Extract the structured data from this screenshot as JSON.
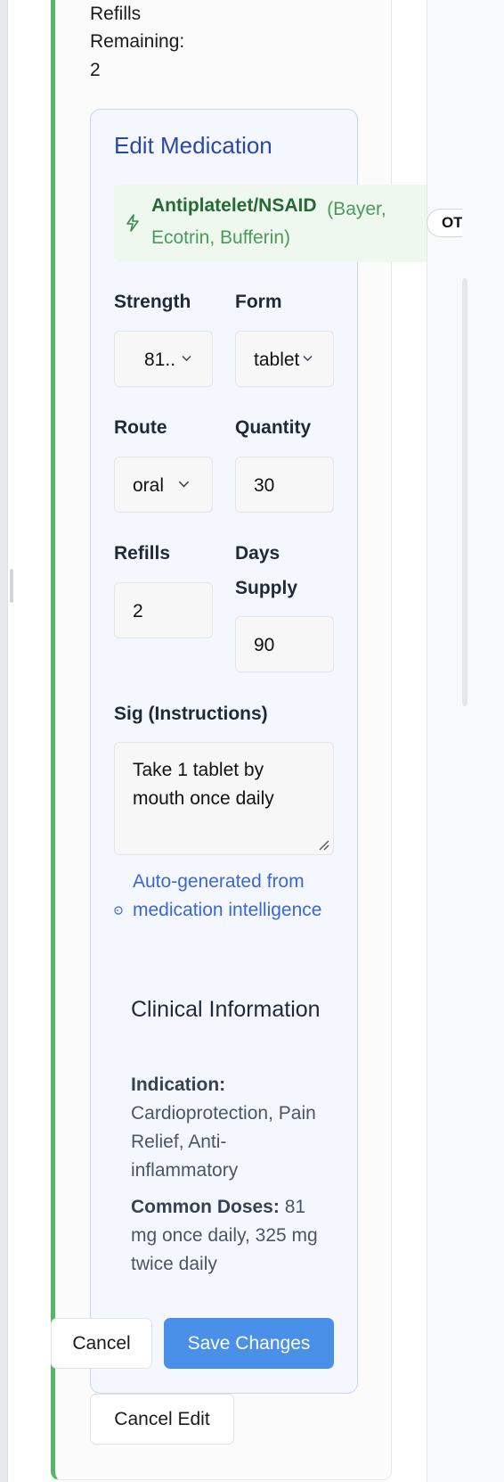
{
  "prescription": {
    "refills_remaining_label_line1": "Refills",
    "refills_remaining_label_line2": "Remaining:",
    "refills_remaining_value": "2"
  },
  "edit": {
    "title": "Edit Medication",
    "alert": {
      "drug_class": "Antiplatelet/NSAID",
      "brands": "(Bayer, Ecotrin, Bufferin)",
      "badge": "OTC",
      "icon": "lightning-icon",
      "color": "#256a35"
    },
    "fields": {
      "strength": {
        "label": "Strength",
        "value": "81..."
      },
      "form": {
        "label": "Form",
        "value": "tablet"
      },
      "route": {
        "label": "Route",
        "value": "oral"
      },
      "quantity": {
        "label": "Quantity",
        "value": "30"
      },
      "refills": {
        "label": "Refills",
        "value": "2"
      },
      "days_supply": {
        "label_line1": "Days",
        "label_line2": "Supply",
        "value": "90"
      }
    },
    "sig": {
      "label": "Sig (Instructions)",
      "value": "Take 1 tablet by mouth once daily"
    },
    "auto_note": "Auto-generated from medication intelligence",
    "clinical": {
      "title": "Clinical Information",
      "indication_label": "Indication:",
      "indication_value": "Cardioprotection, Pain Relief, Anti-inflammatory",
      "doses_label": "Common Doses:",
      "doses_value": "81 mg once daily, 325 mg twice daily"
    },
    "buttons": {
      "cancel": "Cancel",
      "save": "Save Changes",
      "cancel_edit": "Cancel Edit"
    }
  },
  "colors": {
    "accent_green": "#4fba63",
    "primary_blue": "#4a90e8",
    "edit_title": "#2b47a8"
  }
}
